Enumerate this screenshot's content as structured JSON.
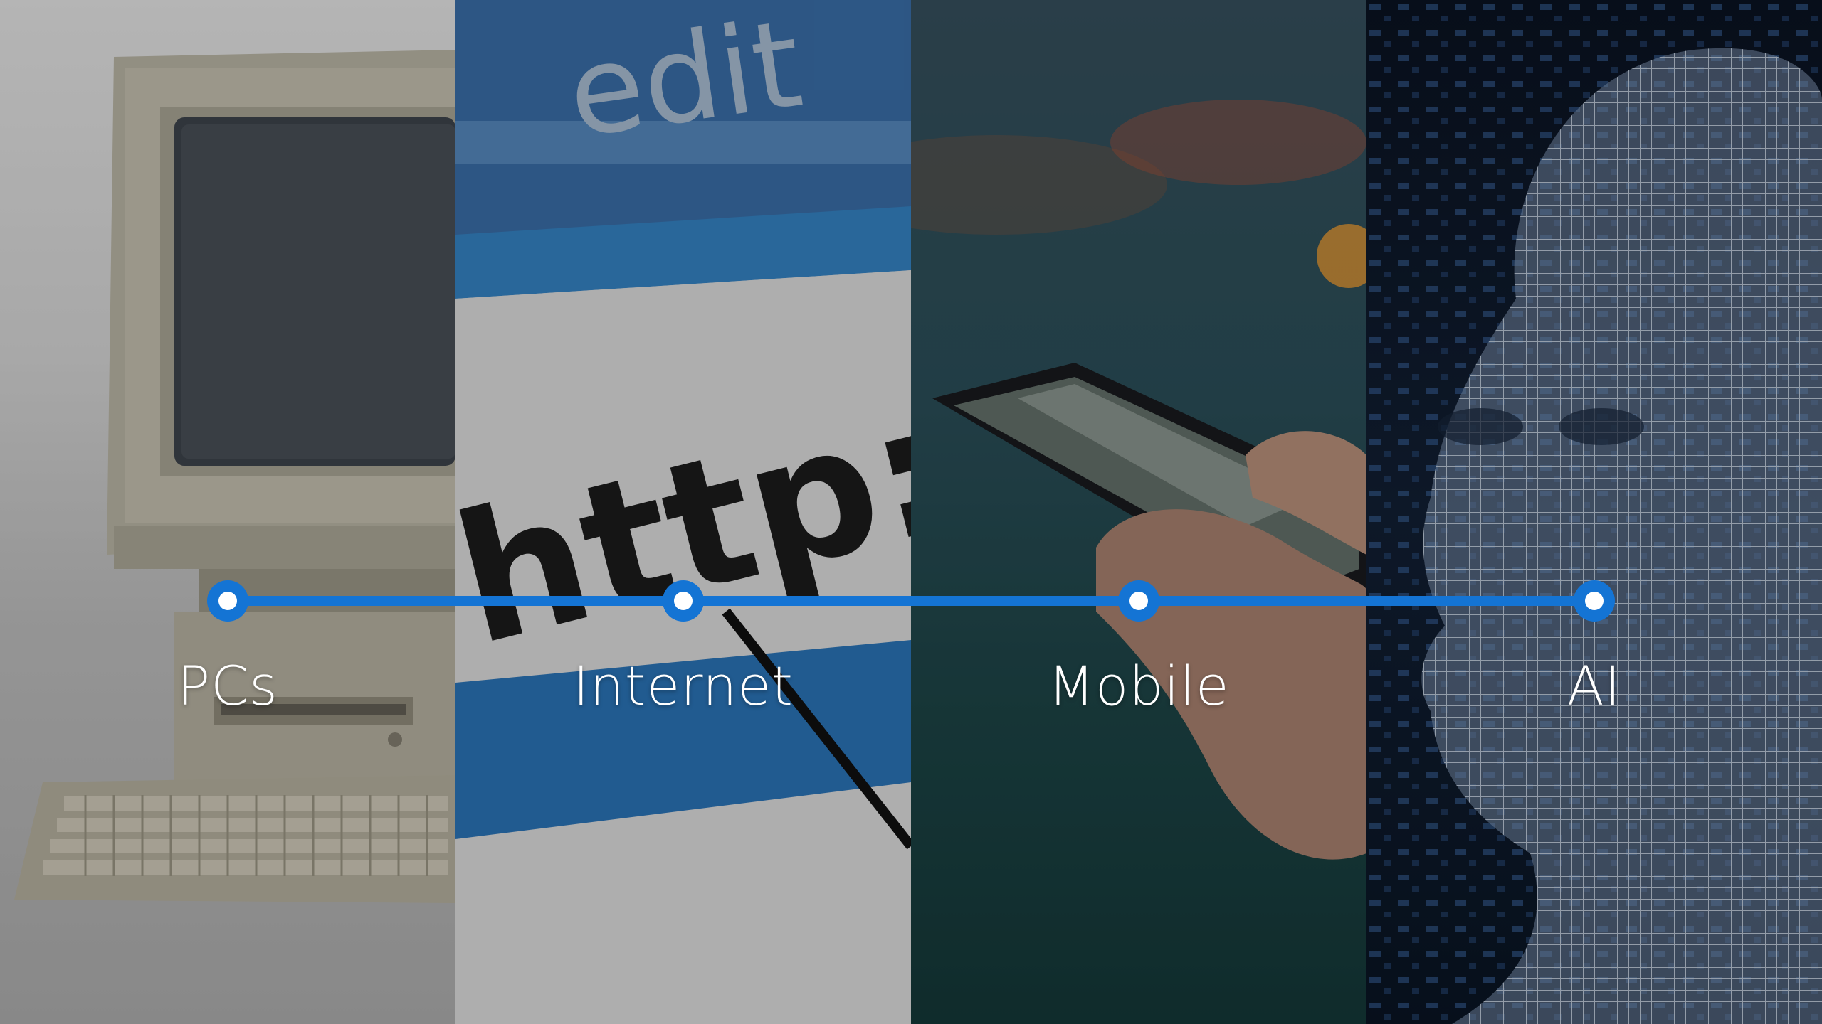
{
  "panels": [
    {
      "id": "pcs",
      "image": "retro-desktop-computer"
    },
    {
      "id": "internet",
      "image": "browser-address-bar-http",
      "overlay_text": {
        "top": "edit",
        "middle": "http://"
      }
    },
    {
      "id": "mobile",
      "image": "hand-holding-smartphone"
    },
    {
      "id": "ai",
      "image": "wireframe-human-head"
    }
  ],
  "timeline": {
    "color": "#1474d4",
    "milestones": [
      {
        "label": "PCs"
      },
      {
        "label": "Internet"
      },
      {
        "label": "Mobile"
      },
      {
        "label": "AI"
      }
    ]
  }
}
